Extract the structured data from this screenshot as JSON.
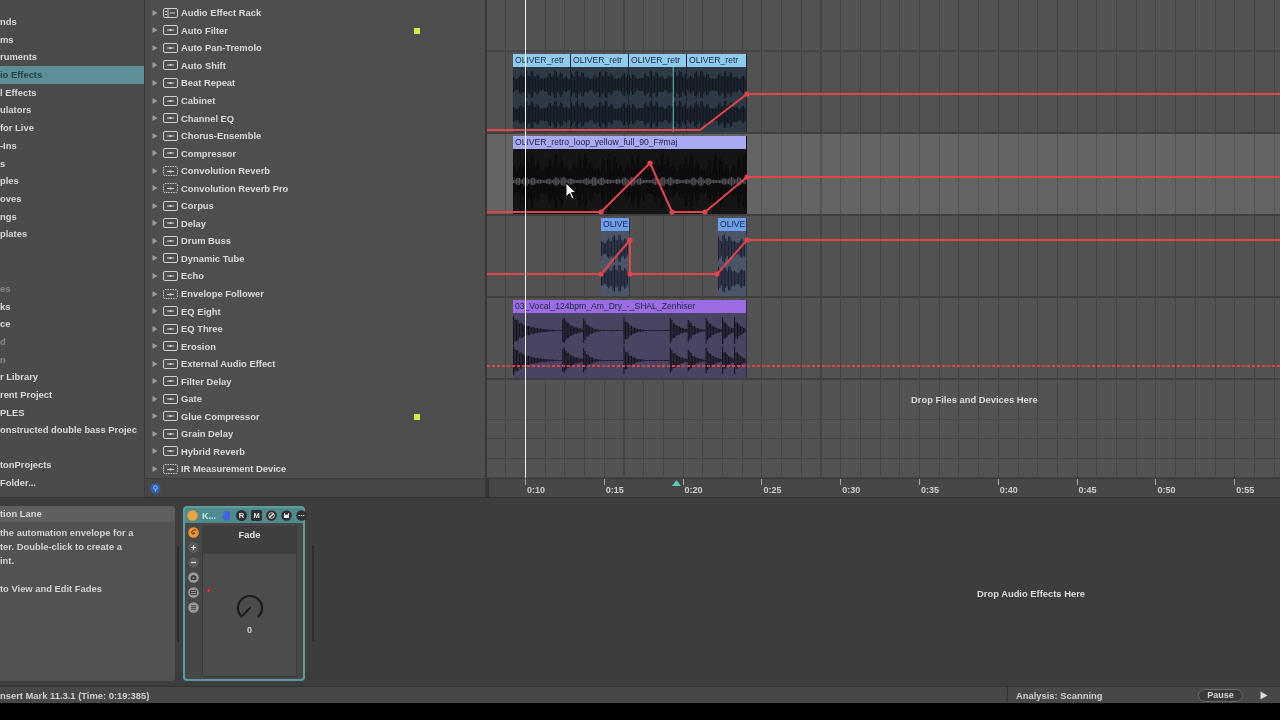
{
  "places_sidebar": {
    "sections": [
      {
        "items": [
          {
            "label": "nds",
            "selected": false,
            "dimmed": false
          },
          {
            "label": "ms",
            "selected": false,
            "dimmed": false
          },
          {
            "label": "ruments",
            "selected": false,
            "dimmed": false
          },
          {
            "label": "io Effects",
            "selected": true,
            "dimmed": false
          },
          {
            "label": "l Effects",
            "selected": false,
            "dimmed": false
          },
          {
            "label": "ulators",
            "selected": false,
            "dimmed": false
          },
          {
            "label": "for Live",
            "selected": false,
            "dimmed": false
          },
          {
            "label": "-Ins",
            "selected": false,
            "dimmed": false
          },
          {
            "label": "s",
            "selected": false,
            "dimmed": false
          },
          {
            "label": "ples",
            "selected": false,
            "dimmed": false
          },
          {
            "label": "oves",
            "selected": false,
            "dimmed": false
          },
          {
            "label": "ngs",
            "selected": false,
            "dimmed": false
          },
          {
            "label": "plates",
            "selected": false,
            "dimmed": false
          }
        ]
      },
      {
        "items": [
          {
            "label": "es",
            "selected": false,
            "dimmed": true
          },
          {
            "label": "ks",
            "selected": false,
            "dimmed": false
          },
          {
            "label": "ce",
            "selected": false,
            "dimmed": false
          },
          {
            "label": "d",
            "selected": false,
            "dimmed": true
          },
          {
            "label": "n",
            "selected": false,
            "dimmed": true
          },
          {
            "label": "r Library",
            "selected": false,
            "dimmed": false
          },
          {
            "label": "rent Project",
            "selected": false,
            "dimmed": false
          },
          {
            "label": "PLES",
            "selected": false,
            "dimmed": false
          },
          {
            "label": "onstructed double bass Projec",
            "selected": false,
            "dimmed": false
          }
        ]
      },
      {
        "items": [
          {
            "label": "tonProjects",
            "selected": false,
            "dimmed": false
          },
          {
            "label": "Folder...",
            "selected": false,
            "dimmed": false
          }
        ]
      }
    ]
  },
  "browser": {
    "items": [
      {
        "label": "Audio Effect Rack",
        "kind": "rack",
        "expanded": false
      },
      {
        "label": "Auto Filter",
        "kind": "device",
        "expanded": false,
        "color": "#d6ea4a"
      },
      {
        "label": "Auto Pan-Tremolo",
        "kind": "device",
        "expanded": false
      },
      {
        "label": "Auto Shift",
        "kind": "device",
        "expanded": false
      },
      {
        "label": "Beat Repeat",
        "kind": "device",
        "expanded": false
      },
      {
        "label": "Cabinet",
        "kind": "device",
        "expanded": false
      },
      {
        "label": "Channel EQ",
        "kind": "device",
        "expanded": false
      },
      {
        "label": "Chorus-Ensemble",
        "kind": "device",
        "expanded": false
      },
      {
        "label": "Compressor",
        "kind": "device",
        "expanded": false
      },
      {
        "label": "Convolution Reverb",
        "kind": "max_device",
        "expanded": false
      },
      {
        "label": "Convolution Reverb Pro",
        "kind": "max_device",
        "expanded": false
      },
      {
        "label": "Corpus",
        "kind": "device",
        "expanded": false
      },
      {
        "label": "Delay",
        "kind": "device",
        "expanded": false
      },
      {
        "label": "Drum Buss",
        "kind": "device",
        "expanded": false
      },
      {
        "label": "Dynamic Tube",
        "kind": "device",
        "expanded": false
      },
      {
        "label": "Echo",
        "kind": "device",
        "expanded": false
      },
      {
        "label": "Envelope Follower",
        "kind": "max_device",
        "expanded": false
      },
      {
        "label": "EQ Eight",
        "kind": "device",
        "expanded": false
      },
      {
        "label": "EQ Three",
        "kind": "device",
        "expanded": false
      },
      {
        "label": "Erosion",
        "kind": "device",
        "expanded": false
      },
      {
        "label": "External Audio Effect",
        "kind": "device",
        "expanded": false
      },
      {
        "label": "Filter Delay",
        "kind": "device",
        "expanded": false
      },
      {
        "label": "Gate",
        "kind": "device",
        "expanded": false
      },
      {
        "label": "Glue Compressor",
        "kind": "device",
        "expanded": false,
        "color": "#d6ea4a"
      },
      {
        "label": "Grain Delay",
        "kind": "device",
        "expanded": false
      },
      {
        "label": "Hybrid Reverb",
        "kind": "device",
        "expanded": false
      },
      {
        "label": "IR Measurement Device",
        "kind": "max_device",
        "expanded": false
      }
    ]
  },
  "arrangement": {
    "tracks": [
      {
        "selected": false,
        "automation_active": true,
        "clips": [
          {
            "name": "OLIVER_retr",
            "color": "#8ecbee"
          },
          {
            "name": "OLIVER_retr",
            "color": "#8ecbee"
          },
          {
            "name": "OLIVER_retr",
            "color": "#8ecbee"
          },
          {
            "name": "OLIVER_retr",
            "color": "#8ecbee"
          }
        ]
      },
      {
        "selected": true,
        "automation_active": true,
        "clips": [
          {
            "name": "OLIVER_retro_loop_yellow_full_90_F#maj",
            "color": "#a9aaf4"
          }
        ]
      },
      {
        "selected": false,
        "automation_active": true,
        "clips": [
          {
            "name": "OLIVE",
            "color": "#6d9ef0"
          },
          {
            "name": "OLIVE",
            "color": "#6d9ef0"
          }
        ]
      },
      {
        "selected": false,
        "automation_active": false,
        "clips": [
          {
            "name": "03_Vocal_124bpm_Am_Dry_-_SHAL_Zenhiser",
            "color": "#9b6ce4"
          }
        ]
      }
    ],
    "drop_hint": "Drop Files and Devices Here",
    "ruler": {
      "labels": [
        "0:10",
        "0:15",
        "0:20",
        "0:25",
        "0:30",
        "0:35",
        "0:40",
        "0:45",
        "0:50",
        "0:55"
      ]
    }
  },
  "detail_view": {
    "info": {
      "title": "tion Lane",
      "paragraphs": [
        "the automation envelope for a\nter. Double-click to create a\nint.",
        "to View and Edit Fades"
      ]
    },
    "device": {
      "selected": true,
      "on": true,
      "name": "K...",
      "buttons": [
        {
          "label": "R",
          "kind": "round"
        },
        {
          "label": "M",
          "kind": "square"
        }
      ],
      "title": "Fade",
      "knob": {
        "value": "0",
        "automated": true
      }
    },
    "drop_hint": "Drop Audio Effects Here"
  },
  "status_bar": {
    "message": "nsert Mark 11.3.1 (Time: 0:19:385)",
    "analysis": "Analysis: Scanning",
    "button": "Pause"
  }
}
